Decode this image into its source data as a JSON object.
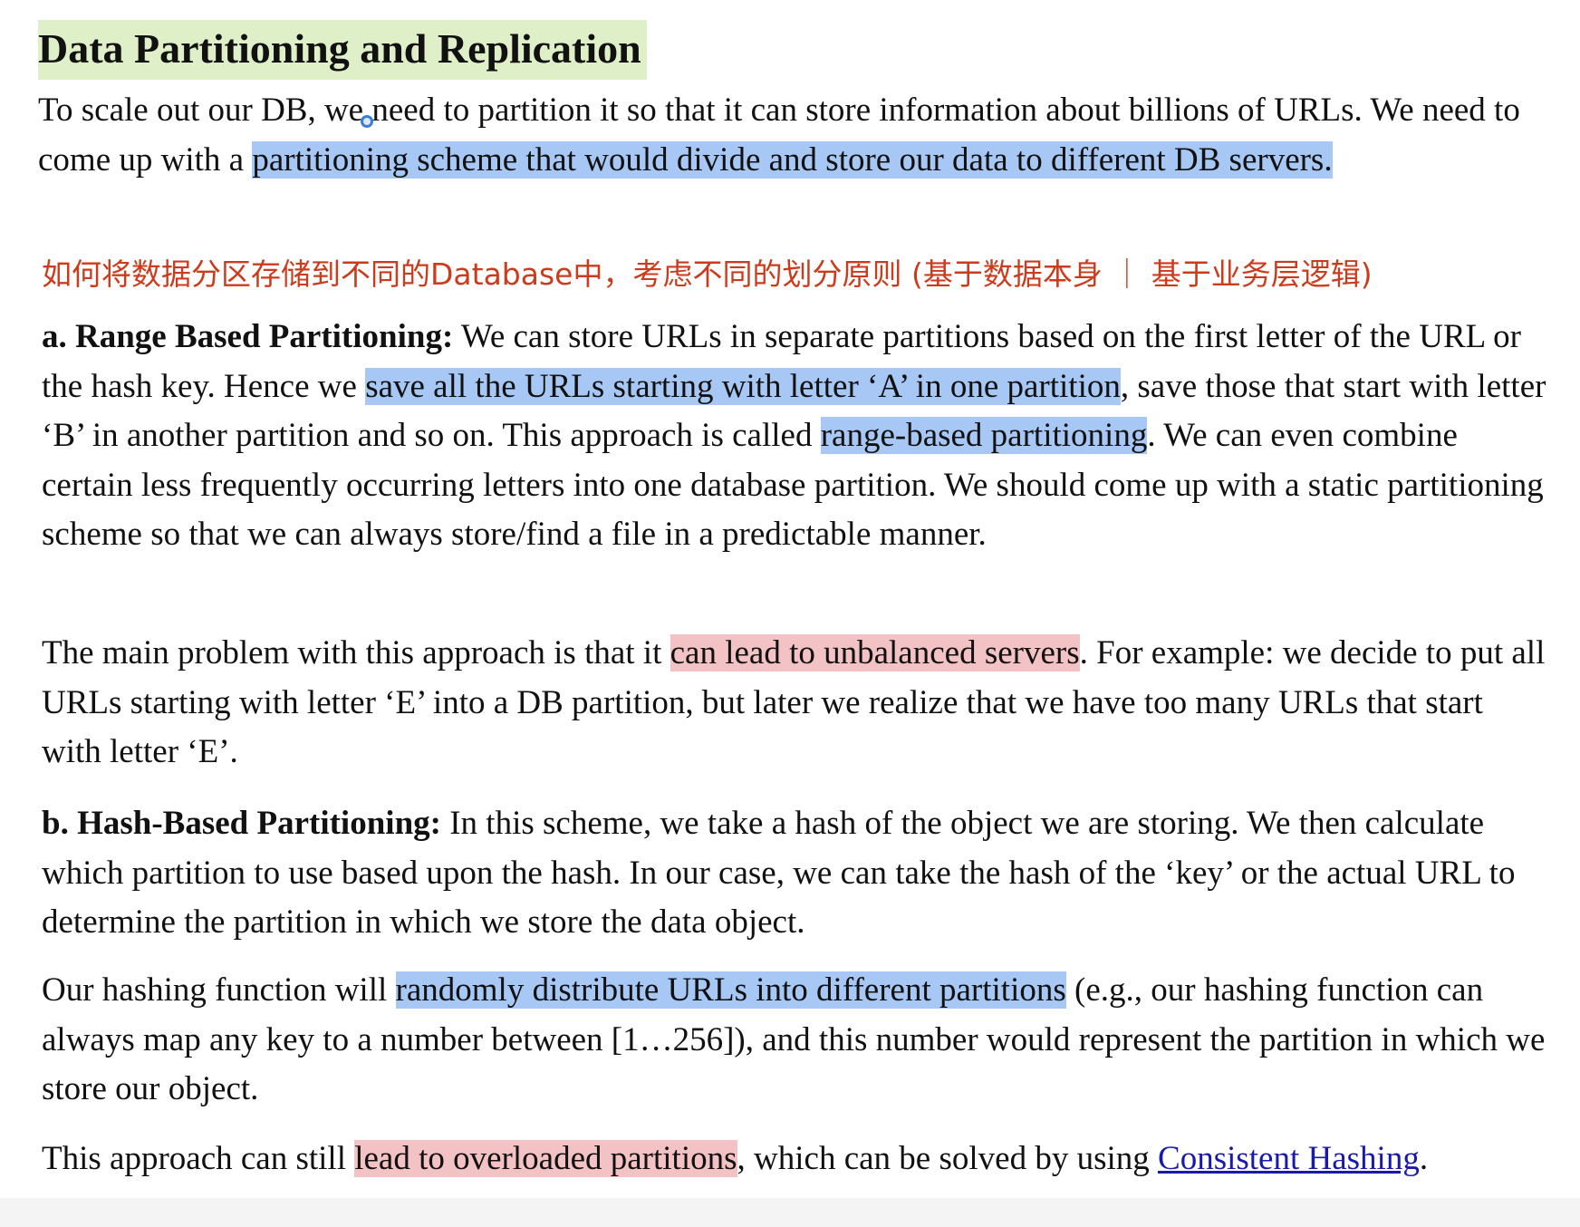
{
  "heading": "Data Partitioning and Replication",
  "intro": {
    "t1": "To scale out our DB, we need to partition it so that it can store information about billions of URLs. We need to come up with a ",
    "h1": "partitioning scheme that would divide and store our data to different DB servers."
  },
  "note": "如何将数据分区存储到不同的Database中，考虑不同的划分原则 (基于数据本身 ｜ 基于业务层逻辑)",
  "range": {
    "label": "a. Range Based Partitioning:",
    "t1": " We can store URLs in separate partitions based on the first letter of the URL or the hash key. Hence we ",
    "h1": "save all the URLs starting with letter ‘A’ in one partition",
    "t2": ", save those that start with letter ‘B’ in another partition and so on. This approach is called ",
    "h2": "range-based partitioning",
    "t3": ". We can even combine certain less frequently occurring letters into one database partition. We should come up with a static partitioning scheme so that we can always store/find a file in a predictable manner."
  },
  "problem": {
    "t1": "The main problem with this approach is that it ",
    "h1": "can lead to unbalanced servers",
    "t2": ". For example: we decide to put all URLs starting with letter ‘E’ into a DB partition, but later we realize that we have too many URLs that start with letter ‘E’."
  },
  "hash": {
    "label": "b. Hash-Based Partitioning:",
    "t1": " In this scheme, we take a hash of the object we are storing. We then calculate which partition to use based upon the hash. In our case, we can take the hash of the ‘key’ or the actual URL to determine the partition in which we store the data object."
  },
  "hashfn": {
    "t1": "Our hashing function will ",
    "h1": "randomly distribute URLs into different partitions",
    "t2": " (e.g., our hashing function can always map any key to a number between [1…256]), and this number would represent the partition in which we store our object."
  },
  "last": {
    "t1": "This approach can still ",
    "h1": "lead to overloaded partitions",
    "t2": ", which can be solved by using ",
    "link": "Consistent Hashing",
    "t3": "."
  },
  "colors": {
    "heading_highlight": "#dff0c8",
    "blue_highlight": "#a7c7f5",
    "red_highlight": "#f3c2c4",
    "note_text": "#cc3b1c",
    "link": "#1a1aa8"
  }
}
